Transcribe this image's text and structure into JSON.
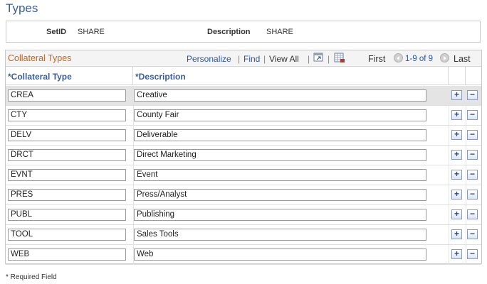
{
  "page": {
    "title": "Types"
  },
  "header": {
    "setid_label": "SetID",
    "setid_value": "SHARE",
    "description_label": "Description",
    "description_value": "SHARE"
  },
  "grid": {
    "title": "Collateral Types",
    "personalize": "Personalize",
    "find": "Find",
    "view_all": "View All",
    "first": "First",
    "range": "1-9 of 9",
    "last": "Last",
    "sep": "|",
    "columns": {
      "type": "*Collateral Type",
      "description": "*Description"
    },
    "rows": [
      {
        "type": "CREA",
        "description": "Creative"
      },
      {
        "type": "CTY",
        "description": "County Fair"
      },
      {
        "type": "DELV",
        "description": "Deliverable"
      },
      {
        "type": "DRCT",
        "description": "Direct Marketing"
      },
      {
        "type": "EVNT",
        "description": "Event"
      },
      {
        "type": "PRES",
        "description": "Press/Analyst"
      },
      {
        "type": "PUBL",
        "description": "Publishing"
      },
      {
        "type": "TOOL",
        "description": "Sales Tools"
      },
      {
        "type": "WEB",
        "description": "Web"
      }
    ],
    "add_symbol": "+",
    "delete_symbol": "−"
  },
  "footer": {
    "note": "* Required Field"
  },
  "icons": {
    "zoom": "zoom-grid-icon",
    "download": "download-excel-icon",
    "prev": "previous-arrow-icon",
    "next": "next-arrow-icon",
    "add": "add-row-icon",
    "delete": "delete-row-icon"
  },
  "colors": {
    "title": "#3a5e9c",
    "grid_title": "#c7641b",
    "link": "#2a56a3"
  }
}
